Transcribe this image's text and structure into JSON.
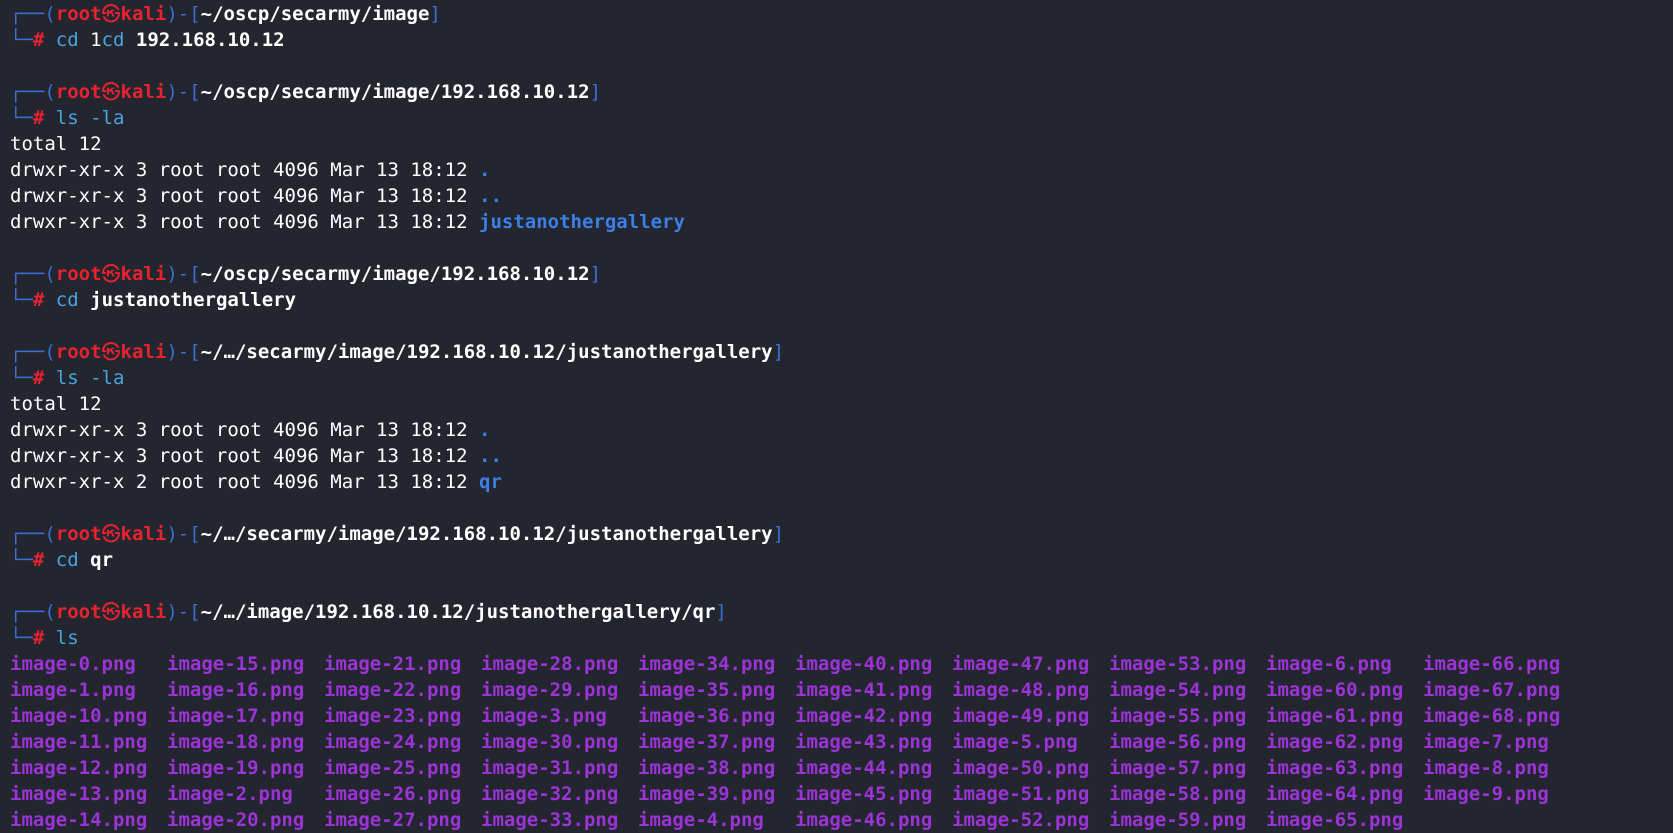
{
  "prompt": {
    "user": "root",
    "at": "㉿",
    "host": "kali",
    "frame_top_left": "┌──(",
    "frame_mid": ")-[",
    "frame_close": "]",
    "frame_bottom": "└─",
    "hash": "#"
  },
  "blocks": [
    {
      "cwd": "~/oscp/secarmy/image",
      "cmd": "cd",
      "args": " 1cd 192.168.10.12",
      "cmd_first_part": "cd ",
      "cmd_second": "1cd",
      "arg": " 192.168.10.12",
      "output": []
    },
    {
      "cwd": "~/oscp/secarmy/image/192.168.10.12",
      "cmd": "ls -la",
      "output": [
        {
          "text": "total 12",
          "name": ""
        },
        {
          "text": "drwxr-xr-x 3 root root 4096 Mar 13 18:12 ",
          "name": "."
        },
        {
          "text": "drwxr-xr-x 3 root root 4096 Mar 13 18:12 ",
          "name": ".."
        },
        {
          "text": "drwxr-xr-x 3 root root 4096 Mar 13 18:12 ",
          "name": "justanothergallery"
        }
      ]
    },
    {
      "cwd": "~/oscp/secarmy/image/192.168.10.12",
      "cmd": "cd",
      "arg": " justanothergallery",
      "output": []
    },
    {
      "cwd": "~/…/secarmy/image/192.168.10.12/justanothergallery",
      "cmd": "ls -la",
      "output": [
        {
          "text": "total 12",
          "name": ""
        },
        {
          "text": "drwxr-xr-x 3 root root 4096 Mar 13 18:12 ",
          "name": "."
        },
        {
          "text": "drwxr-xr-x 3 root root 4096 Mar 13 18:12 ",
          "name": ".."
        },
        {
          "text": "drwxr-xr-x 2 root root 4096 Mar 13 18:12 ",
          "name": "qr"
        }
      ]
    },
    {
      "cwd": "~/…/secarmy/image/192.168.10.12/justanothergallery",
      "cmd": "cd",
      "arg": " qr",
      "output": []
    },
    {
      "cwd": "~/…/image/192.168.10.12/justanothergallery/qr",
      "cmd": "ls",
      "output": []
    }
  ],
  "ls_files": [
    [
      "image-0.png",
      "image-15.png",
      "image-21.png",
      "image-28.png",
      "image-34.png",
      "image-40.png",
      "image-47.png",
      "image-53.png",
      "image-6.png",
      "image-66.png"
    ],
    [
      "image-1.png",
      "image-16.png",
      "image-22.png",
      "image-29.png",
      "image-35.png",
      "image-41.png",
      "image-48.png",
      "image-54.png",
      "image-60.png",
      "image-67.png"
    ],
    [
      "image-10.png",
      "image-17.png",
      "image-23.png",
      "image-3.png",
      "image-36.png",
      "image-42.png",
      "image-49.png",
      "image-55.png",
      "image-61.png",
      "image-68.png"
    ],
    [
      "image-11.png",
      "image-18.png",
      "image-24.png",
      "image-30.png",
      "image-37.png",
      "image-43.png",
      "image-5.png",
      "image-56.png",
      "image-62.png",
      "image-7.png"
    ],
    [
      "image-12.png",
      "image-19.png",
      "image-25.png",
      "image-31.png",
      "image-38.png",
      "image-44.png",
      "image-50.png",
      "image-57.png",
      "image-63.png",
      "image-8.png"
    ],
    [
      "image-13.png",
      "image-2.png",
      "image-26.png",
      "image-32.png",
      "image-39.png",
      "image-45.png",
      "image-51.png",
      "image-58.png",
      "image-64.png",
      "image-9.png"
    ],
    [
      "image-14.png",
      "image-20.png",
      "image-27.png",
      "image-33.png",
      "image-4.png",
      "image-46.png",
      "image-52.png",
      "image-59.png",
      "image-65.png",
      ""
    ]
  ],
  "colors": {
    "background": "#23252f",
    "frame": "#3b6fd4",
    "prompt_red": "#e8232f",
    "command": "#4aa3e0",
    "directory": "#3c7fe6",
    "png_file": "#9b33d6"
  }
}
